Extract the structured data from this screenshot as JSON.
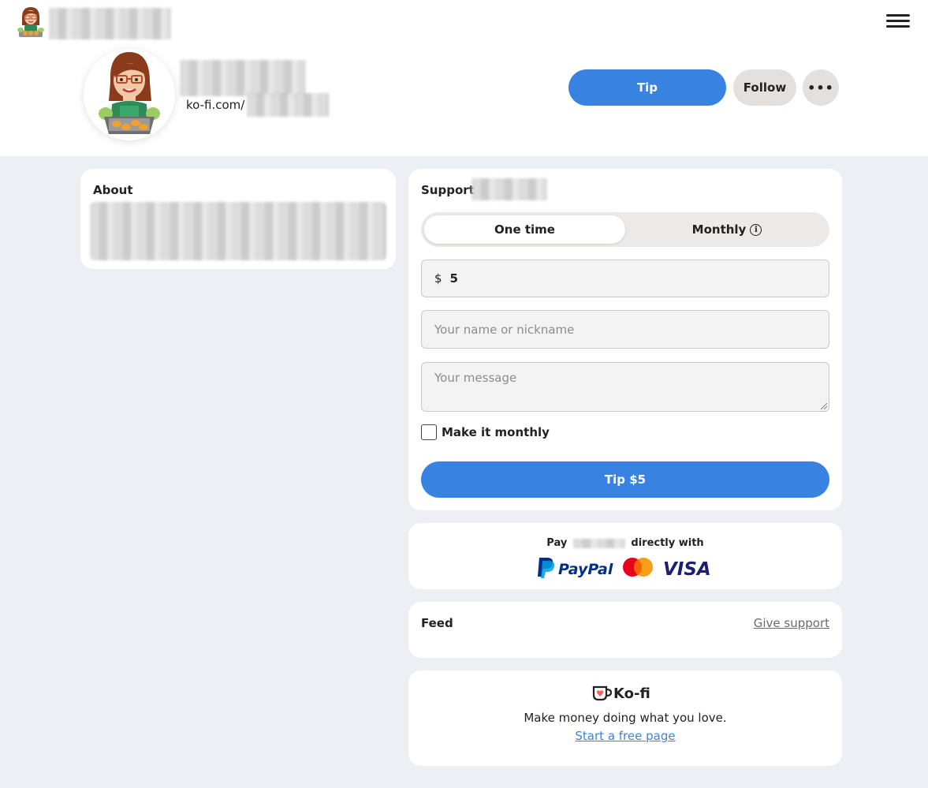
{
  "header": {
    "menu_icon": "hamburger-menu-icon"
  },
  "profile": {
    "url_prefix": "ko-fi.com/",
    "tip_label": "Tip",
    "follow_label": "Follow",
    "more_label": "•••"
  },
  "about": {
    "title": "About"
  },
  "support": {
    "title": "Support",
    "tabs": [
      {
        "label": "One time",
        "selected": true
      },
      {
        "label": "Monthly",
        "selected": false
      }
    ],
    "monthly_info_icon": "info-icon",
    "currency_symbol": "$",
    "amount": "5",
    "name_placeholder": "Your name or nickname",
    "message_placeholder": "Your message",
    "make_monthly_label": "Make it monthly",
    "make_monthly_checked": false,
    "submit_label": "Tip $5"
  },
  "pay": {
    "prefix": "Pay",
    "suffix": "directly with",
    "methods": [
      "PayPal",
      "Mastercard",
      "VISA"
    ]
  },
  "feed": {
    "title": "Feed",
    "give_support_label": "Give support"
  },
  "footer": {
    "brand": "Ko-fi",
    "tagline": "Make money doing what you love.",
    "cta_label": "Start a free page"
  },
  "colors": {
    "accent": "#3883e2",
    "page_bg": "#eceff4",
    "button_neutral": "#e3e0de"
  }
}
